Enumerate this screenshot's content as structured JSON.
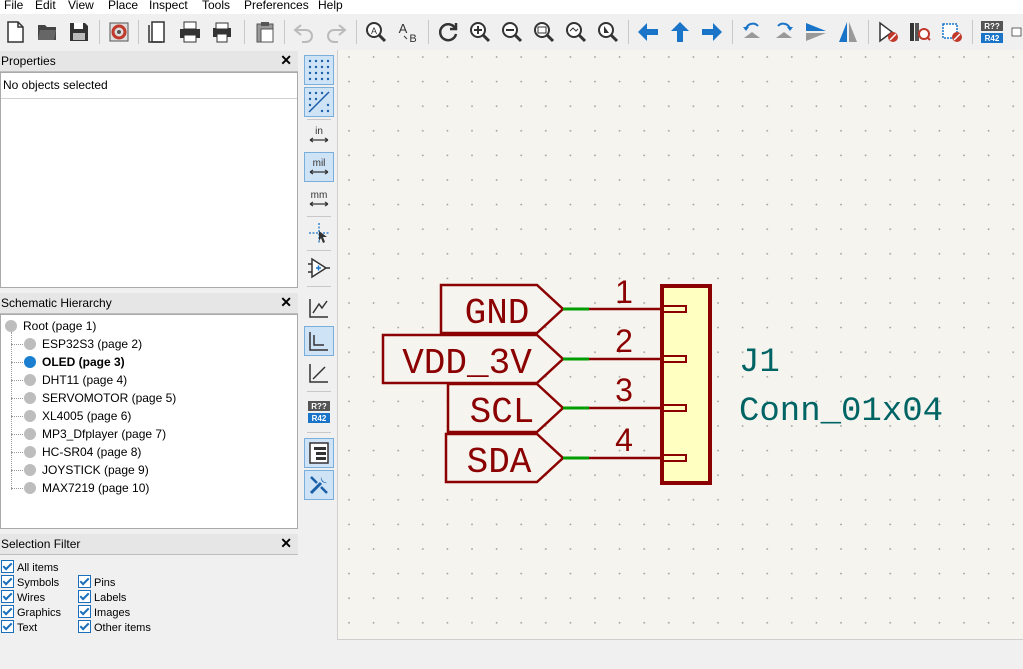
{
  "menu": [
    "File",
    "Edit",
    "View",
    "Place",
    "Inspect",
    "Tools",
    "Preferences",
    "Help"
  ],
  "toolbar_icons": [
    "new-icon",
    "open-icon",
    "save-icon",
    "schematic-setup-icon",
    "page-settings-icon",
    "print-icon",
    "plot-icon",
    "paste-icon",
    "undo-icon",
    "redo-icon",
    "find-icon",
    "find-replace-icon",
    "refresh-icon",
    "zoom-in-icon",
    "zoom-out-icon",
    "zoom-fit-icon",
    "zoom-objects-icon",
    "zoom-selection-icon",
    "arrow-left-icon",
    "arrow-up-icon",
    "arrow-right-icon",
    "rotate-ccw-icon",
    "rotate-cw-icon",
    "mirror-vertical-icon",
    "mirror-horizontal-icon",
    "symbol-editor-icon",
    "symbol-browser-icon",
    "annotate-icon",
    "erc-icon",
    "annotate-refs-icon"
  ],
  "properties": {
    "title": "Properties",
    "close": "✕",
    "status": "No objects selected"
  },
  "hierarchy": {
    "title": "Schematic Hierarchy",
    "close": "✕",
    "root": "Root (page 1)",
    "items": [
      {
        "label": "ESP32S3 (page 2)",
        "active": false
      },
      {
        "label": "OLED (page 3)",
        "active": true
      },
      {
        "label": "DHT11 (page 4)",
        "active": false
      },
      {
        "label": "SERVOMOTOR (page 5)",
        "active": false
      },
      {
        "label": "XL4005 (page 6)",
        "active": false
      },
      {
        "label": "MP3_Dfplayer (page 7)",
        "active": false
      },
      {
        "label": "HC-SR04 (page 8)",
        "active": false
      },
      {
        "label": "JOYSTICK (page 9)",
        "active": false
      },
      {
        "label": "MAX7219 (page 10)",
        "active": false
      }
    ]
  },
  "selection_filter": {
    "title": "Selection Filter",
    "close": "✕",
    "left": [
      "All items",
      "Symbols",
      "Wires",
      "Graphics",
      "Text"
    ],
    "right": [
      "Pins",
      "Labels",
      "Images",
      "Other items"
    ]
  },
  "left_toolbar": {
    "grid_icons": [
      "grid-dots-icon",
      "grid-overrides-icon"
    ],
    "units": [
      "in",
      "mil",
      "mm"
    ],
    "active_unit": "mil",
    "badge": [
      "R??",
      "R42"
    ]
  },
  "schematic": {
    "labels": [
      "GND",
      "VDD_3V",
      "SCL",
      "SDA"
    ],
    "pin_numbers": [
      "1",
      "2",
      "3",
      "4"
    ],
    "reference": "J1",
    "value": "Conn_01x04",
    "colors": {
      "label": "#8b0000",
      "symbol_fill": "#ffffc2",
      "wire": "#009c00",
      "ref_text": "#006464",
      "canvas_bg": "#f5f4ef"
    }
  }
}
